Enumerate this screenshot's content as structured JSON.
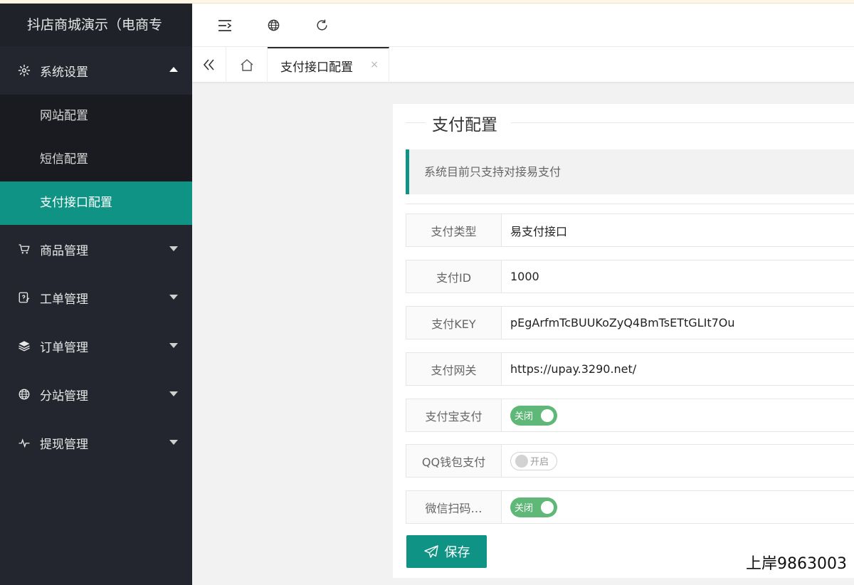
{
  "app": {
    "title": "抖店商城演示（电商专"
  },
  "sidebar": {
    "groups": [
      {
        "label": "系统设置",
        "icon": "gear-icon",
        "expanded": true,
        "items": [
          {
            "label": "网站配置",
            "active": false
          },
          {
            "label": "短信配置",
            "active": false
          },
          {
            "label": "支付接口配置",
            "active": true
          }
        ]
      },
      {
        "label": "商品管理",
        "icon": "cart-icon",
        "expanded": false
      },
      {
        "label": "工单管理",
        "icon": "ticket-edit-icon",
        "expanded": false
      },
      {
        "label": "订单管理",
        "icon": "layers-icon",
        "expanded": false
      },
      {
        "label": "分站管理",
        "icon": "globe-icon",
        "expanded": false
      },
      {
        "label": "提现管理",
        "icon": "pulse-icon",
        "expanded": false
      }
    ]
  },
  "header": {
    "buttons": [
      "menu-toggle-icon",
      "globe-icon",
      "refresh-icon"
    ]
  },
  "tabs": {
    "active_label": "支付接口配置",
    "close_symbol": "×"
  },
  "content": {
    "section_title": "支付配置",
    "notice": "系统目前只支持对接易支付",
    "fields": [
      {
        "label": "支付类型",
        "value": "易支付接口"
      },
      {
        "label": "支付ID",
        "value": "1000"
      },
      {
        "label": "支付KEY",
        "value": "pEgArfmTcBUUKoZyQ4BmTsETtGLIt7Ou"
      },
      {
        "label": "支付网关",
        "value": "https://upay.3290.net/"
      }
    ],
    "toggles": [
      {
        "label": "支付宝支付",
        "state_text": "关闭",
        "on": true
      },
      {
        "label": "QQ钱包支付",
        "state_text": "开启",
        "on": false
      },
      {
        "label": "微信扫码…",
        "state_text": "关闭",
        "on": true
      }
    ],
    "save_label": "保存"
  },
  "watermark": "上岸9863003",
  "colors": {
    "accent": "#0f9384",
    "sidebar_bg": "#23262e",
    "switch_on": "#5fb878"
  }
}
